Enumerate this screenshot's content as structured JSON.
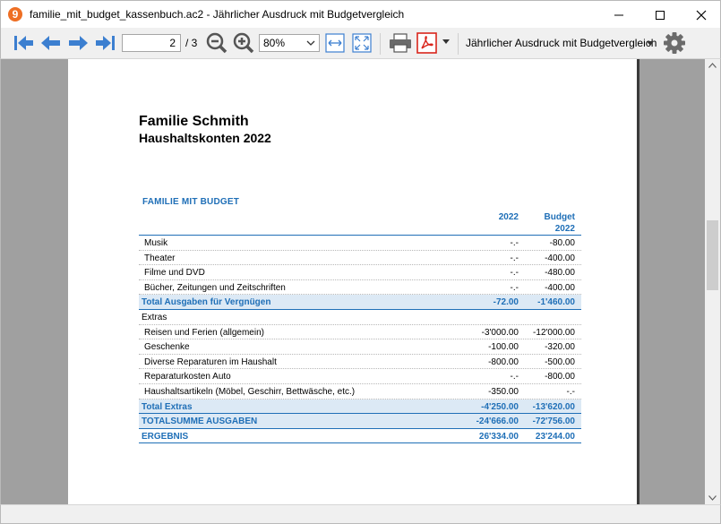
{
  "window": {
    "app_icon_glyph": "9",
    "title": "familie_mit_budget_kassenbuch.ac2 - Jährlicher Ausdruck mit Budgetvergleich"
  },
  "toolbar": {
    "page_value": "2",
    "page_total": "/ 3",
    "zoom_value": "80%",
    "report_name": "Jährlicher Ausdruck mit Budgetvergleich"
  },
  "report": {
    "title": "Familie Schmith",
    "subtitle": "Haushaltskonten 2022",
    "section_title": "FAMILIE MIT BUDGET",
    "col1_header": "2022",
    "col2_header_line1": "Budget",
    "col2_header_line2": "2022",
    "rows": [
      {
        "label": "Musik",
        "v1": "-.-",
        "v2": "-80.00",
        "kind": "item"
      },
      {
        "label": "Theater",
        "v1": "-.-",
        "v2": "-400.00",
        "kind": "item"
      },
      {
        "label": "Filme und DVD",
        "v1": "-.-",
        "v2": "-480.00",
        "kind": "item"
      },
      {
        "label": "Bücher, Zeitungen und Zeitschriften",
        "v1": "-.-",
        "v2": "-400.00",
        "kind": "item"
      },
      {
        "label": "Total Ausgaben für Vergnügen",
        "v1": "-72.00",
        "v2": "-1'460.00",
        "kind": "total"
      },
      {
        "label": "Extras",
        "v1": "",
        "v2": "",
        "kind": "group"
      },
      {
        "label": "Reisen und Ferien (allgemein)",
        "v1": "-3'000.00",
        "v2": "-12'000.00",
        "kind": "item"
      },
      {
        "label": "Geschenke",
        "v1": "-100.00",
        "v2": "-320.00",
        "kind": "item"
      },
      {
        "label": "Diverse Reparaturen im Haushalt",
        "v1": "-800.00",
        "v2": "-500.00",
        "kind": "item"
      },
      {
        "label": "Reparaturkosten Auto",
        "v1": "-.-",
        "v2": "-800.00",
        "kind": "item"
      },
      {
        "label": "Haushaltsartikeln (Möbel, Geschirr, Bettwäsche, etc.)",
        "v1": "-350.00",
        "v2": "-.-",
        "kind": "item"
      },
      {
        "label": "Total Extras",
        "v1": "-4'250.00",
        "v2": "-13'620.00",
        "kind": "total"
      },
      {
        "label": "TOTALSUMME AUSGABEN",
        "v1": "-24'666.00",
        "v2": "-72'756.00",
        "kind": "sum"
      },
      {
        "label": "ERGEBNIS",
        "v1": "26'334.00",
        "v2": "23'244.00",
        "kind": "result"
      }
    ]
  },
  "colors": {
    "accent": "#1f6fb7",
    "nav_arrow": "#3c7fd0",
    "pdf_red": "#d9261c",
    "app_orange": "#ee6f24"
  },
  "icons": [
    "arrow-first-icon",
    "arrow-prev-icon",
    "arrow-next-icon",
    "arrow-last-icon",
    "zoom-out-icon",
    "zoom-in-icon",
    "fit-width-icon",
    "fit-page-icon",
    "printer-icon",
    "pdf-icon",
    "gear-icon"
  ]
}
